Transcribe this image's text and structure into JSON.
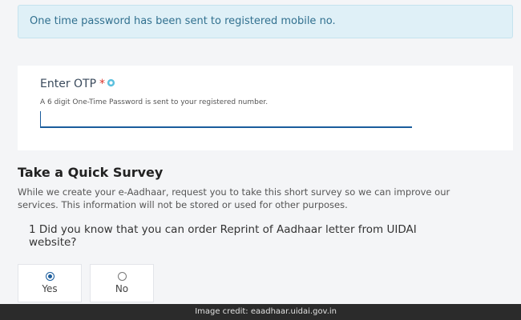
{
  "alert": {
    "message": "One time password has been sent to registered mobile no."
  },
  "otp": {
    "label": "Enter OTP",
    "required_mark": "*",
    "help_text": "A 6 digit One-Time Password is sent to your registered number.",
    "value": ""
  },
  "survey": {
    "title": "Take a Quick Survey",
    "description": "While we create your e-Aadhaar, request you to take this short survey so we can improve our services. This information will not be stored or used for other purposes.",
    "question": "1 Did you know that you can order Reprint of Aadhaar letter from UIDAI website?",
    "options": [
      {
        "label": "Yes",
        "selected": true
      },
      {
        "label": "No",
        "selected": false
      }
    ]
  },
  "credit": {
    "text": "Image credit: eaadhaar.uidai.gov.in"
  },
  "colors": {
    "alert_bg": "#dff0f7",
    "alert_text": "#31708f",
    "accent": "#1a5c9c",
    "required": "#d9342b"
  },
  "icons": {
    "info": "info-icon"
  }
}
